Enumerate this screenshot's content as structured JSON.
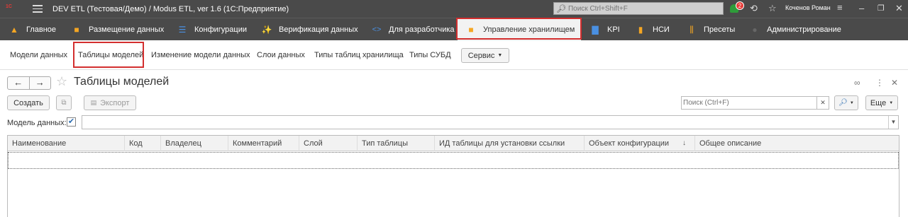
{
  "titlebar": {
    "title": "DEV ETL (Тестовая/Демо) / Modus ETL, ver 1.6  (1С:Предприятие)",
    "search_placeholder": "Поиск Ctrl+Shift+F",
    "notifications_count": "2",
    "user": "Коченов Роман"
  },
  "sections": [
    {
      "label": "Главное",
      "icon": "house-icon"
    },
    {
      "label": "Размещение данных",
      "icon": "database-icon"
    },
    {
      "label": "Конфигурации",
      "icon": "hierarchy-icon"
    },
    {
      "label": "Верификация данных",
      "icon": "magic-wand-icon"
    },
    {
      "label": "Для разработчика",
      "icon": "code-icon"
    },
    {
      "label": "Управление хранилищем",
      "icon": "storage-settings-icon",
      "active": true
    },
    {
      "label": "KPI",
      "icon": "bar-chart-icon"
    },
    {
      "label": "НСИ",
      "icon": "book-icon"
    },
    {
      "label": "Пресеты",
      "icon": "sliders-icon"
    },
    {
      "label": "Администрирование",
      "icon": "admin-icon"
    }
  ],
  "subnav": [
    {
      "label": "Модели данных"
    },
    {
      "label": "Таблицы моделей",
      "active": true
    },
    {
      "label": "Изменение модели данных"
    },
    {
      "label": "Слои данных"
    },
    {
      "label": "Типы таблиц хранилища"
    },
    {
      "label": "Типы СУБД"
    }
  ],
  "service_menu": "Сервис",
  "form": {
    "title": "Таблицы моделей",
    "create_label": "Создать",
    "export_label": "Экспорт",
    "search_placeholder": "Поиск (Ctrl+F)",
    "more_label": "Еще",
    "filter_label": "Модель данных:",
    "filter_checked": true,
    "filter_value": ""
  },
  "table": {
    "columns": [
      "Наименование",
      "Код",
      "Владелец",
      "Комментарий",
      "Слой",
      "Тип таблицы",
      "ИД таблицы для установки ссылки",
      "Объект конфигурации",
      "Общее описание"
    ],
    "sorted_column": "Объект конфигурации",
    "rows": []
  },
  "colors": {
    "topbar": "#4a4a4a",
    "highlight": "#d32f2f",
    "accent": "#2e9c3a"
  }
}
